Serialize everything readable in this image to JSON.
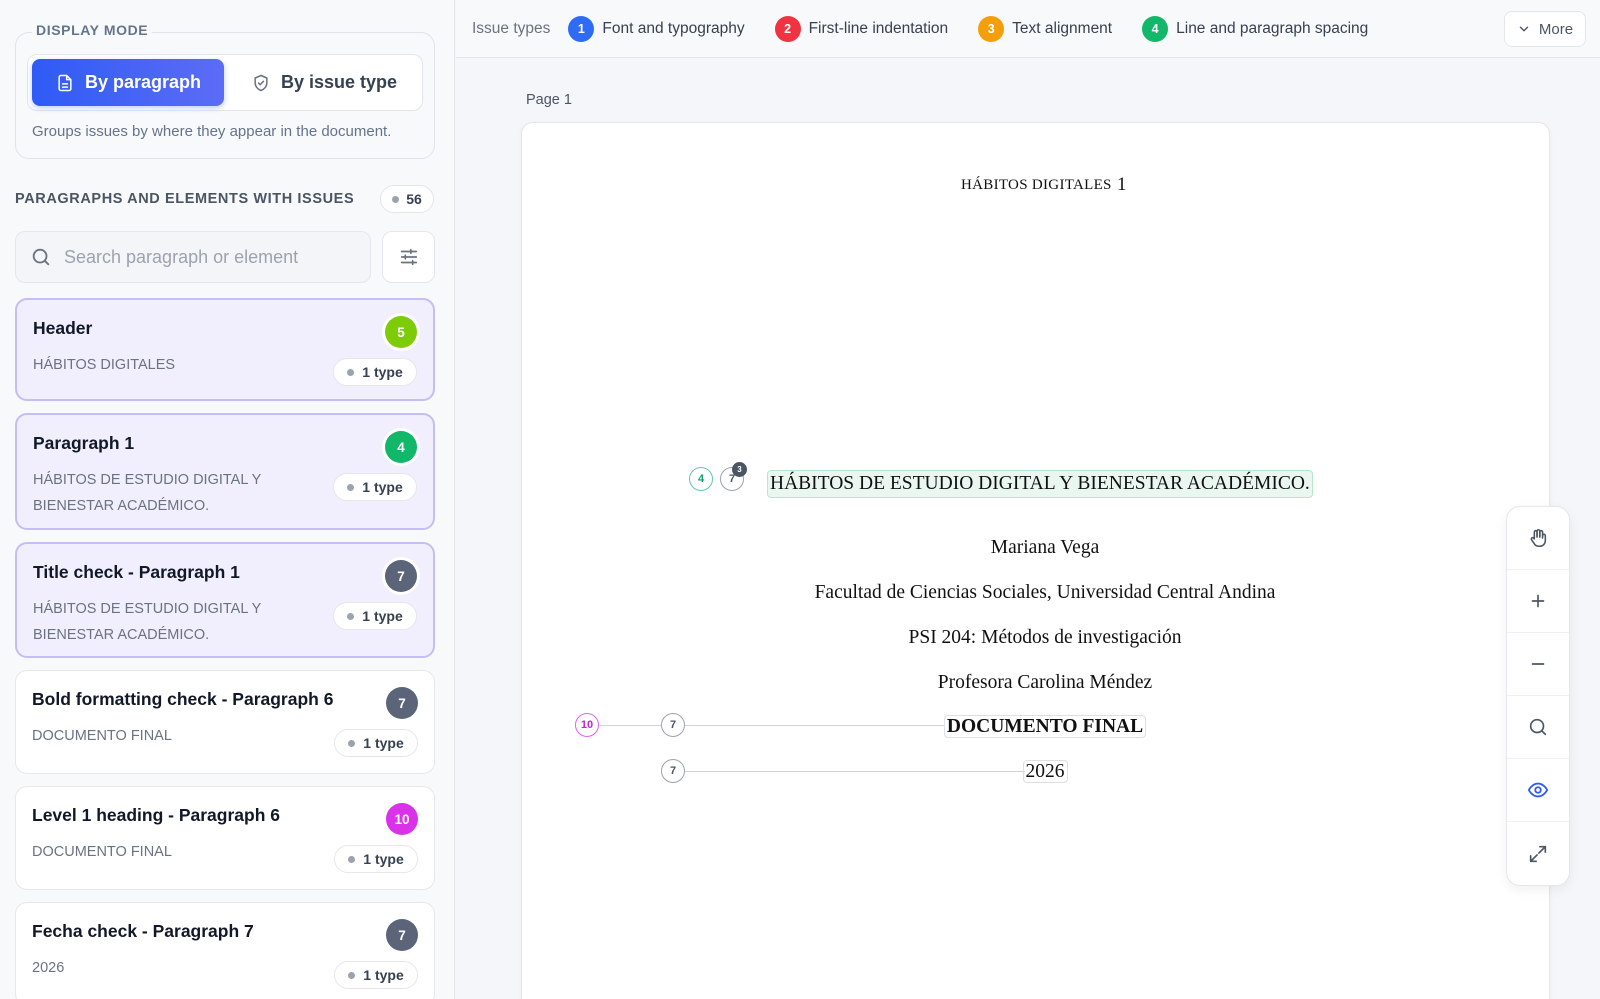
{
  "sidebar": {
    "display_mode": {
      "legend": "DISPLAY MODE",
      "by_paragraph": "By paragraph",
      "by_issue_type": "By issue type",
      "description": "Groups issues by where they appear in the document."
    },
    "list_heading": "PARAGRAPHS AND ELEMENTS WITH ISSUES",
    "issue_count": "56",
    "search": {
      "placeholder": "Search paragraph or element"
    },
    "cards": [
      {
        "title": "Header",
        "subtitle": "HÁBITOS DIGITALES",
        "badge": "5",
        "badge_color": "#7ecb0a",
        "types": "1 type",
        "highlighted": true
      },
      {
        "title": "Paragraph 1",
        "subtitle": "HÁBITOS DE ESTUDIO DIGITAL Y BIENESTAR ACADÉMICO.",
        "badge": "4",
        "badge_color": "#12b76a",
        "types": "1 type",
        "highlighted": true
      },
      {
        "title": "Title check - Paragraph 1",
        "subtitle": "HÁBITOS DE ESTUDIO DIGITAL Y BIENESTAR ACADÉMICO.",
        "badge": "7",
        "badge_color": "#5b6478",
        "types": "1 type",
        "highlighted": true
      },
      {
        "title": "Bold formatting check - Paragraph 6",
        "subtitle": "DOCUMENTO FINAL",
        "badge": "7",
        "badge_color": "#5b6478",
        "types": "1 type",
        "highlighted": false
      },
      {
        "title": "Level 1 heading - Paragraph 6",
        "subtitle": "DOCUMENTO FINAL",
        "badge": "10",
        "badge_color": "#d932e8",
        "types": "1 type",
        "highlighted": false
      },
      {
        "title": "Fecha check - Paragraph 7",
        "subtitle": "2026",
        "badge": "7",
        "badge_color": "#5b6478",
        "types": "1 type",
        "highlighted": false
      }
    ]
  },
  "topbar": {
    "issue_types_label": "Issue types",
    "issues": [
      {
        "num": "1",
        "label": "Font and typography",
        "color": "#2e6cf6"
      },
      {
        "num": "2",
        "label": "First-line indentation",
        "color": "#ef3340"
      },
      {
        "num": "3",
        "label": "Text alignment",
        "color": "#f59e0b"
      },
      {
        "num": "4",
        "label": "Line and paragraph spacing",
        "color": "#12b76a"
      }
    ],
    "more": "More"
  },
  "document": {
    "page_label": "Page 1",
    "running_head": "HÁBITOS DIGITALES",
    "page_number": "1",
    "title": "HÁBITOS DE ESTUDIO DIGITAL Y BIENESTAR ACADÉMICO.",
    "author": "Mariana Vega",
    "affiliation": "Facultad de Ciencias Sociales, Universidad Central Andina",
    "course": "PSI 204: Métodos de investigación",
    "instructor": "Profesora Carolina Méndez",
    "heading": "DOCUMENTO FINAL",
    "date": "2026",
    "markers": {
      "title_spacing": "4",
      "title_check": "7",
      "title_check_sub": "3",
      "heading_level": "10",
      "heading_bold": "7",
      "date_check": "7"
    }
  },
  "tools": [
    "hand-icon",
    "zoom-in-icon",
    "zoom-out-icon",
    "search-icon",
    "eye-icon",
    "expand-icon"
  ]
}
